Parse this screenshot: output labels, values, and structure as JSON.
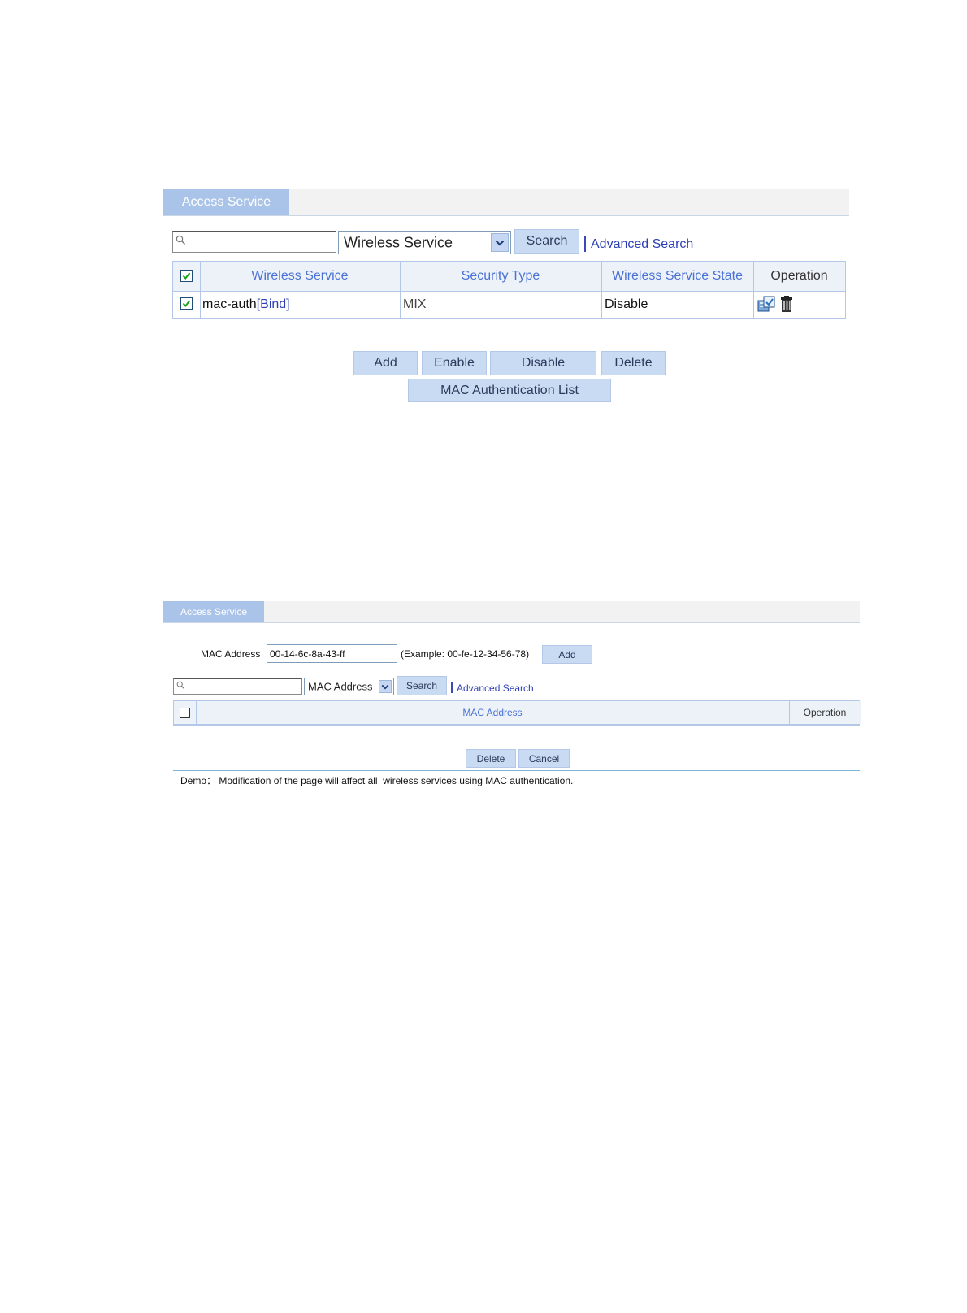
{
  "panel1": {
    "tab_label": "Access Service",
    "search": {
      "value": "",
      "select_value": "Wireless Service",
      "search_button": "Search",
      "advanced_link": "Advanced Search"
    },
    "table": {
      "headers": [
        "Wireless Service",
        "Security Type",
        "Wireless Service State",
        "Operation"
      ],
      "rows": [
        {
          "name": "mac-auth",
          "bind_link": "[Bind]",
          "security_type": "MIX",
          "state": "Disable",
          "checked": true
        }
      ]
    },
    "buttons": {
      "add": "Add",
      "enable": "Enable",
      "disable": "Disable",
      "delete": "Delete",
      "mac_list": "MAC Authentication List"
    }
  },
  "panel2": {
    "tab_label": "Access Service",
    "mac_label": "MAC Address",
    "mac_value": "00-14-6c-8a-43-ff",
    "mac_example": "(Example: 00-fe-12-34-56-78)",
    "add_button": "Add",
    "search": {
      "value": "",
      "select_value": "MAC Address",
      "search_button": "Search",
      "advanced_link": "Advanced Search"
    },
    "table": {
      "headers": [
        "MAC Address",
        "Operation"
      ]
    },
    "buttons": {
      "delete": "Delete",
      "cancel": "Cancel"
    },
    "demo_label": "Demo：",
    "demo_text": "Modification of the page will affect all  wireless services using MAC authentication."
  },
  "icons": [
    "search-icon",
    "chevron-down-icon",
    "checkbox-checked-icon",
    "checkbox-icon",
    "edit-icon",
    "trash-icon"
  ],
  "colors": {
    "tab": "#aac3e8",
    "button": "#c9daf3",
    "header_text": "#4a72d4",
    "link": "#2d3fb5",
    "border": "#b3c8e8"
  }
}
